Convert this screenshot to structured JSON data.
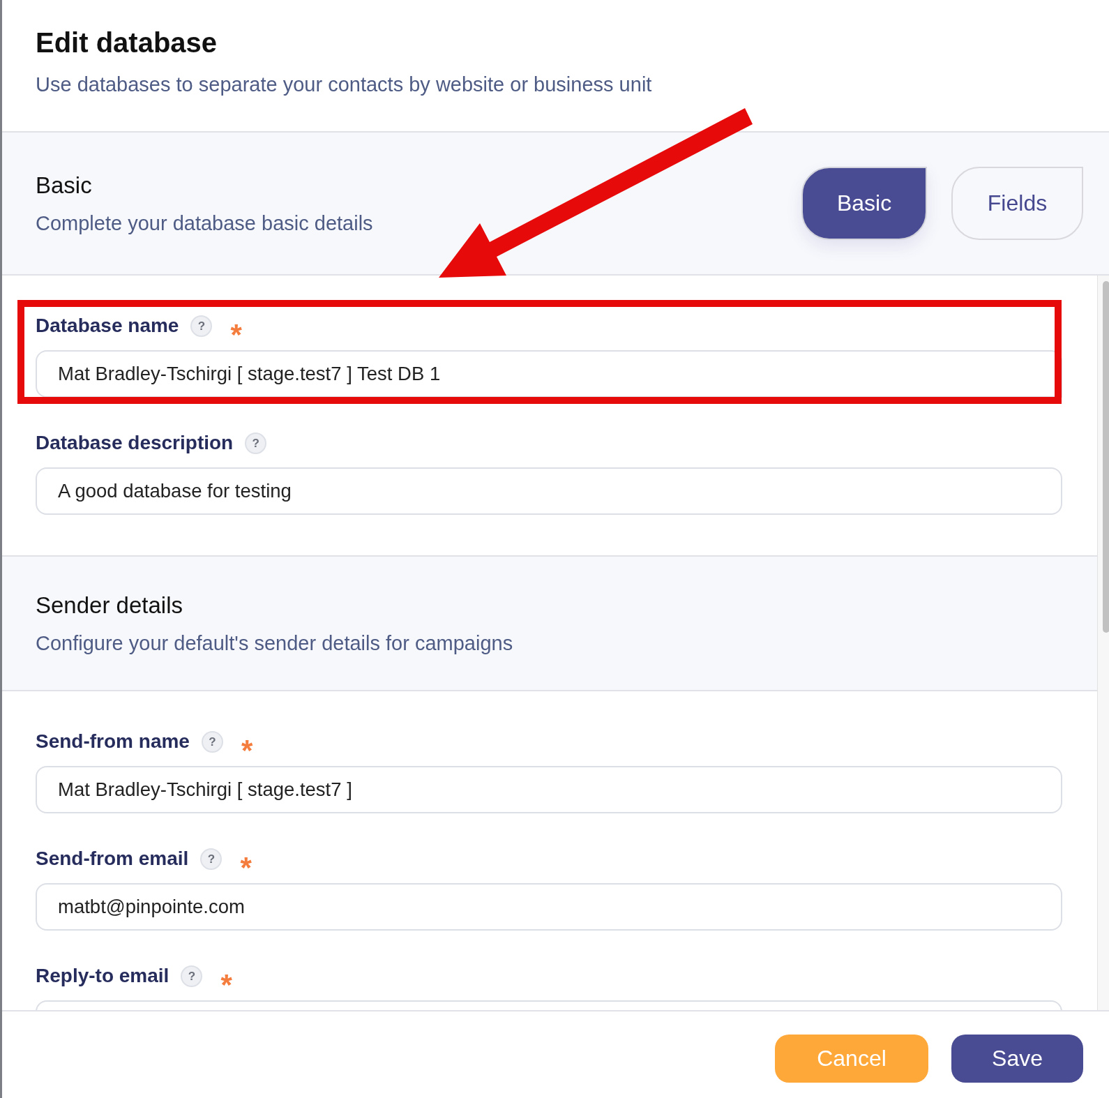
{
  "dialog": {
    "title": "Edit database",
    "subtitle": "Use databases to separate your contacts by website or business unit"
  },
  "tabs": [
    {
      "label": "Basic",
      "selected": true
    },
    {
      "label": "Fields",
      "selected": false
    }
  ],
  "sections": [
    {
      "title": "Basic",
      "subtitle": "Complete your database basic details",
      "fields": [
        {
          "label": "Database name",
          "help": "?",
          "required_mark": "*",
          "value": "Mat Bradley-Tschirgi [ stage.test7 ] Test DB 1",
          "highlighted": true
        },
        {
          "label": "Database description",
          "help": "?",
          "value": "A good database for testing",
          "highlighted": false
        }
      ]
    },
    {
      "title": "Sender details",
      "subtitle": "Configure your default's sender details for campaigns",
      "fields": [
        {
          "label": "Send-from name",
          "help": "?",
          "required_mark": "*",
          "value": "Mat Bradley-Tschirgi [ stage.test7 ]",
          "highlighted": false
        },
        {
          "label": "Send-from email",
          "help": "?",
          "required_mark": "*",
          "value": "matbt@pinpointe.com",
          "highlighted": false
        },
        {
          "label": "Reply-to email",
          "help": "?",
          "required_mark": "*",
          "highlighted": false
        }
      ]
    }
  ],
  "footer_buttons": [
    {
      "label": "Cancel",
      "kind": "secondary"
    },
    {
      "label": "Save",
      "kind": "primary"
    }
  ]
}
